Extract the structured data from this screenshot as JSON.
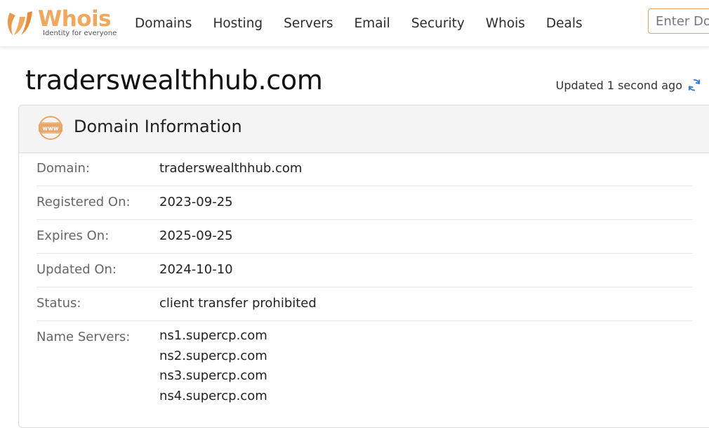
{
  "brand": {
    "name": "Whois",
    "tagline": "Identity for everyone",
    "color": "#f0a95c"
  },
  "nav": {
    "items": [
      {
        "label": "Domains"
      },
      {
        "label": "Hosting"
      },
      {
        "label": "Servers"
      },
      {
        "label": "Email"
      },
      {
        "label": "Security"
      },
      {
        "label": "Whois"
      },
      {
        "label": "Deals"
      }
    ]
  },
  "search": {
    "placeholder": "Enter Domain"
  },
  "page": {
    "domain_title": "traderswealthhub.com",
    "updated_text": "Updated 1 second ago",
    "refresh_icon": "refresh-icon",
    "refresh_color": "#3a7bd5"
  },
  "domain_info": {
    "heading": "Domain Information",
    "icon": "www-icon",
    "rows": [
      {
        "label": "Domain:",
        "value": "traderswealthhub.com"
      },
      {
        "label": "Registered On:",
        "value": "2023-09-25"
      },
      {
        "label": "Expires On:",
        "value": "2025-09-25"
      },
      {
        "label": "Updated On:",
        "value": "2024-10-10"
      },
      {
        "label": "Status:",
        "value": "client transfer prohibited"
      }
    ],
    "name_servers_label": "Name Servers:",
    "name_servers": [
      "ns1.supercp.com",
      "ns2.supercp.com",
      "ns3.supercp.com",
      "ns4.supercp.com"
    ]
  }
}
